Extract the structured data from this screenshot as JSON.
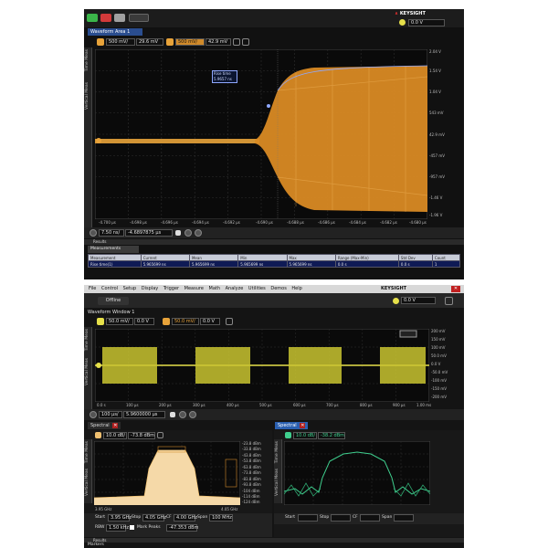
{
  "top": {
    "brand": "KEYSIGHT",
    "vbox": "0.0 V",
    "window_title": "Waveform Area 1",
    "ch1": {
      "scale": "500 mV/",
      "offset": "29.6 mV"
    },
    "ch2": {
      "scale": "500 mV/",
      "offset": "42.9 mV"
    },
    "left_tabs": [
      "Time Meas",
      "Vertical Meas"
    ],
    "marker": {
      "label": "Rise time",
      "value": "5.9657 ns"
    },
    "y_ticks": [
      "2.04 V",
      "1.54 V",
      "1.04 V",
      "543 mV",
      "42.9 mV",
      "-457 mV",
      "-957 mV",
      "-1.46 V",
      "-1.96 V"
    ],
    "x_ticks": [
      "-4.700 µs",
      "-4.698 µs",
      "-4.696 µs",
      "-4.694 µs",
      "-4.692 µs",
      "-4.690 µs",
      "-4.688 µs",
      "-4.686 µs",
      "-4.684 µs",
      "-4.682 µs",
      "-4.680 µs"
    ],
    "timebase": "7.50 ns/",
    "delay": "-4.6897875 µs",
    "results_label": "Results",
    "measurements_tab": "Measurements",
    "table": {
      "headers": [
        "Measurement",
        "Current",
        "Mean",
        "Min",
        "Max",
        "Range (Max-Min)",
        "Std Dev",
        "Count"
      ],
      "rows": [
        [
          "Rise time(1)",
          "5.965699 ns",
          "5.965699 ns",
          "5.965699 ns",
          "5.965699 ns",
          "0.0 s",
          "0.0 s",
          "1"
        ]
      ]
    }
  },
  "bottom": {
    "menu": [
      "File",
      "Control",
      "Setup",
      "Display",
      "Trigger",
      "Measure",
      "Math",
      "Analyze",
      "Utilities",
      "Demos",
      "Help"
    ],
    "brand": "KEYSIGHT",
    "offline": "Offline",
    "vbox": "0.0 V",
    "window_title": "Waveform Window 1",
    "ch1": {
      "scale": "50.0 mV/",
      "offset": "0.0 V"
    },
    "ch2": {
      "scale": "50.0 mV/",
      "offset": "0.0 V"
    },
    "left_tabs": [
      "Time Meas",
      "Vertical Meas"
    ],
    "y_ticks": [
      "200 mV",
      "150 mV",
      "100 mV",
      "50.0 mV",
      "0.0 V",
      "-50.0 mV",
      "-100 mV",
      "-150 mV",
      "-200 mV"
    ],
    "x_ticks": [
      "0.0 s",
      "100 µs",
      "200 µs",
      "300 µs",
      "400 µs",
      "500 µs",
      "600 µs",
      "700 µs",
      "800 µs",
      "900 µs",
      "1.00 ms"
    ],
    "timebase": "100 µs/",
    "delay": "5.9600000 µs",
    "spectral1": {
      "tab": "Spectral",
      "scale": "10.0 dB/",
      "ref": "-73.8 dBm",
      "y_ticks": [
        "-23.8 dBm",
        "-33.8 dBm",
        "-43.8 dBm",
        "-53.8 dBm",
        "-63.8 dBm",
        "-73.8 dBm",
        "-83.8 dBm",
        "-93.8 dBm",
        "-104 dBm",
        "-114 dBm",
        "-124 dBm"
      ],
      "start": "3.95 GHz",
      "stop": "4.05 GHz",
      "cf": "4.00 GHz",
      "span": "100 MHz",
      "rbw": "1.50 kHz",
      "mark_peaks": "Mark Peaks",
      "peak": "-47.353 dBm",
      "x_left": "3.95 GHz",
      "x_right": "4.05 GHz"
    },
    "spectral2": {
      "tab": "Spectral",
      "scale": "10.0 dB/",
      "ref": "-38.2 dBm"
    },
    "results_label": "Results",
    "markers_label": "Markers"
  },
  "labels": {
    "start": "Start",
    "stop": "Stop",
    "cf": "CF",
    "span": "Span",
    "rbw": "RBW"
  },
  "colors": {
    "ch_orange": "#e8a33a",
    "ch_yellow": "#e6e04a",
    "ch_green": "#3fcf8e",
    "spectrum_fill": "#f5d9a8"
  }
}
